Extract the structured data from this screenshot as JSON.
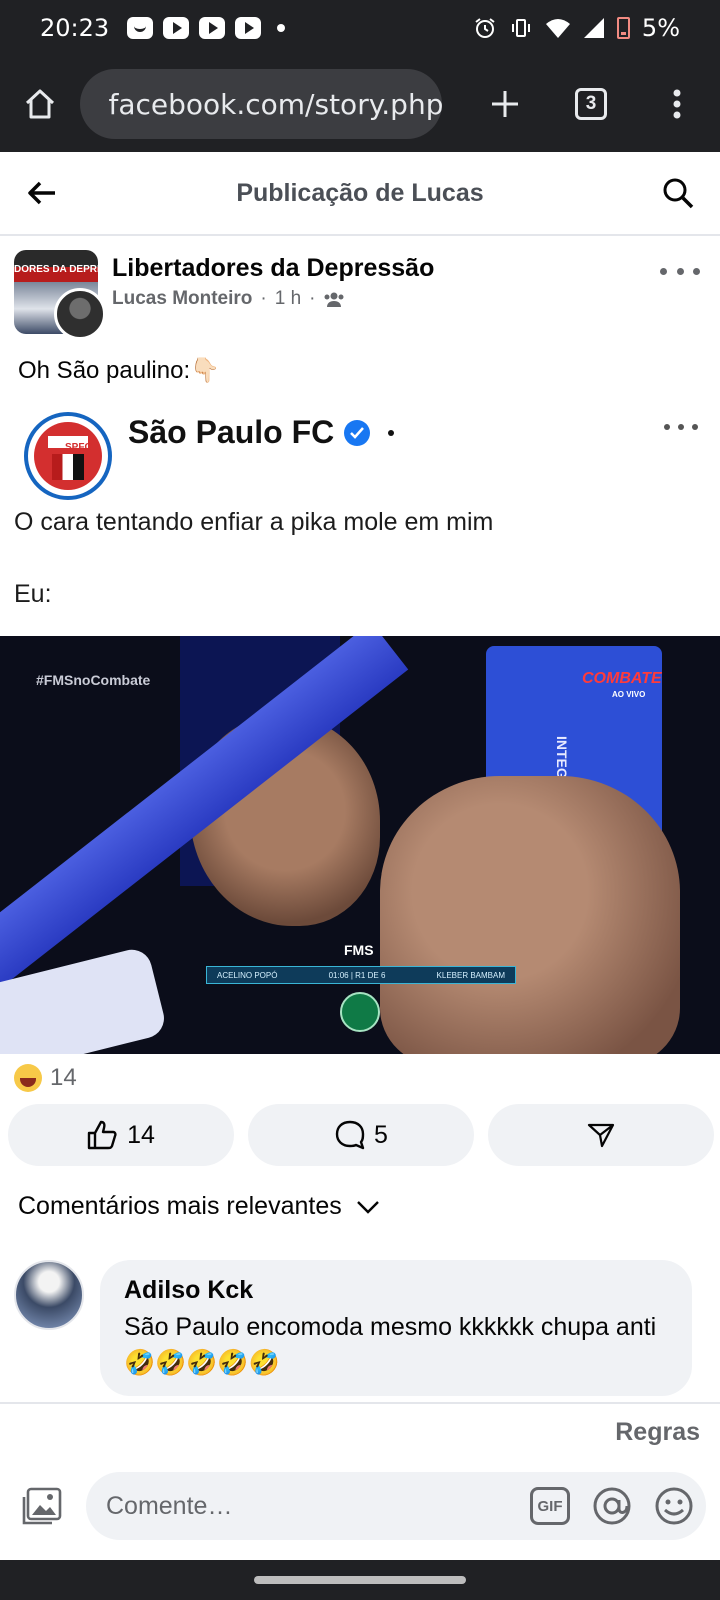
{
  "status_bar": {
    "time": "20:23",
    "battery_percent": "5%"
  },
  "browser": {
    "url": "facebook.com/story.php",
    "tab_count": "3"
  },
  "page_header": {
    "title": "Publicação de Lucas"
  },
  "post": {
    "group_name": "Libertadores da Depressão",
    "group_avatar_text": "DORES DA DEPRESSÃO",
    "author": "Lucas Monteiro",
    "time": "1 h",
    "text": "Oh São paulino:👇🏻",
    "embed": {
      "account_name": "São Paulo FC",
      "logo_text": "SPFC",
      "caption": "O cara tentando enfiar a pika mole em mim",
      "second_line": "Eu:",
      "video": {
        "hashtag": "#FMSnoCombate",
        "broadcaster": "COMBATE",
        "broadcaster_sub": "AO VIVO",
        "pad_text": "INTEGRAL MÉDICA",
        "event_logo": "FMS",
        "fighter_left": "ACELINO POPÓ",
        "clock": "01:06 | R1 DE 6",
        "fighter_right": "KLEBER BAMBAM"
      }
    },
    "reactions_count": "14",
    "actions": {
      "like_count": "14",
      "comment_count": "5"
    }
  },
  "comments": {
    "filter_label": "Comentários mais relevantes",
    "items": [
      {
        "author": "Adilso Kck",
        "text": "São Paulo encomoda mesmo kkkkkk chupa anti 🤣🤣🤣🤣🤣"
      }
    ]
  },
  "footer": {
    "rules_label": "Regras",
    "comment_placeholder": "Comente…",
    "gif_label": "GIF"
  },
  "colors": {
    "fb_blue": "#1877f2",
    "secondary_text": "#65676b",
    "pill_bg": "#f0f2f5",
    "chrome_dark": "#202124"
  }
}
